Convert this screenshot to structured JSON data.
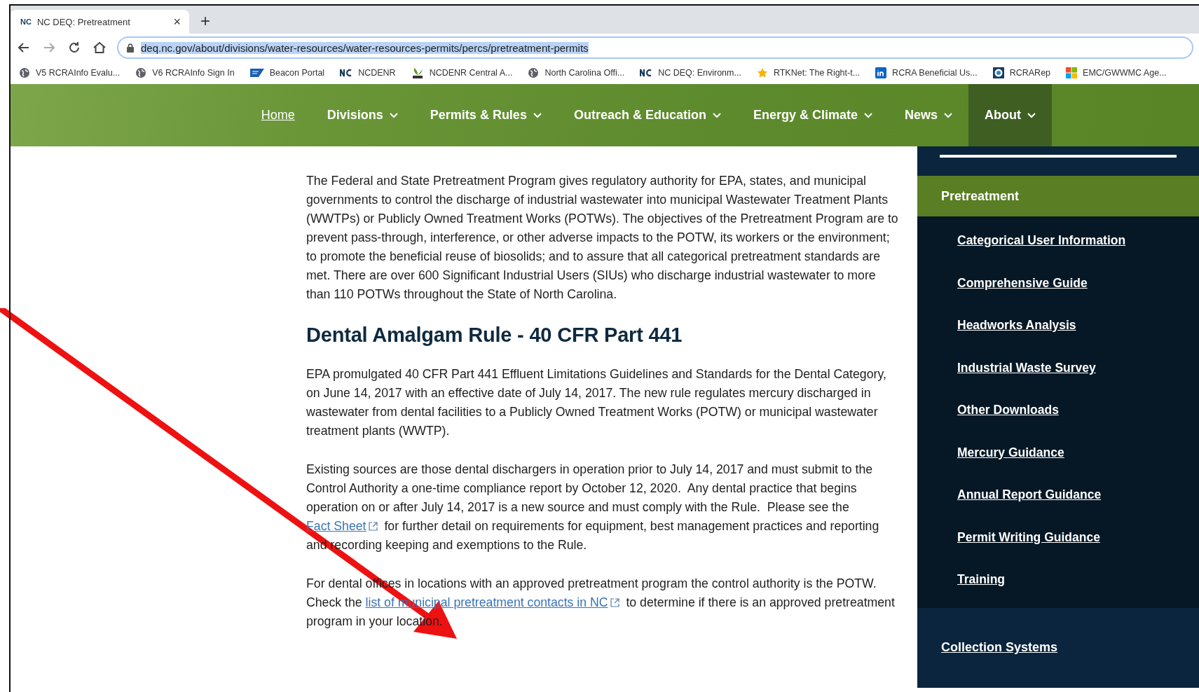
{
  "browser": {
    "tab": {
      "logo": "NC",
      "title": "NC DEQ: Pretreatment",
      "close": "×"
    },
    "new_tab": "+",
    "url": "deq.nc.gov/about/divisions/water-resources/water-resources-permits/percs/pretreatment-permits",
    "forward_disabled": true,
    "bookmarks": [
      {
        "kind": "globe",
        "label": "V5 RCRAInfo  Evalu..."
      },
      {
        "kind": "globe",
        "label": "V6 RCRAInfo Sign In"
      },
      {
        "kind": "sap",
        "label": "Beacon Portal"
      },
      {
        "kind": "nc",
        "label": "NCDENR"
      },
      {
        "kind": "denr",
        "label": "NCDENR Central A..."
      },
      {
        "kind": "globe",
        "label": "North Carolina Offi..."
      },
      {
        "kind": "nc",
        "label": "NC DEQ: Environm..."
      },
      {
        "kind": "star",
        "label": "RTKNet: The Right-t..."
      },
      {
        "kind": "linkedin",
        "label": "RCRA Beneficial Us..."
      },
      {
        "kind": "seal",
        "label": "RCRARep"
      },
      {
        "kind": "windows",
        "label": "EMC/GWWMC Age..."
      }
    ]
  },
  "nav": [
    {
      "label": "Home",
      "has_menu": false,
      "selected": false
    },
    {
      "label": "Divisions",
      "has_menu": true,
      "selected": false
    },
    {
      "label": "Permits & Rules",
      "has_menu": true,
      "selected": false
    },
    {
      "label": "Outreach & Education",
      "has_menu": true,
      "selected": false
    },
    {
      "label": "Energy & Climate",
      "has_menu": true,
      "selected": false
    },
    {
      "label": "News",
      "has_menu": true,
      "selected": false
    },
    {
      "label": "About",
      "has_menu": true,
      "selected": true
    }
  ],
  "content": [
    {
      "kind": "paragraph",
      "parts": [
        {
          "text": "The Federal and State Pretreatment Program gives regulatory authority for EPA, states, and municipal governments to control the discharge of industrial wastewater into municipal Wastewater Treatment Plants (WWTPs) or Publicly Owned Treatment Works (POTWs). The objectives of the Pretreatment Program are to prevent pass-through, interference, or other adverse impacts to the POTW, its workers or the environment; to promote the beneficial reuse of biosolids; and to assure that all categorical pretreatment standards are met. There are over 600 Significant Industrial Users (SIUs) who discharge industrial wastewater to more than 110 POTWs throughout the State of North Carolina."
        }
      ]
    },
    {
      "kind": "heading",
      "text": "Dental Amalgam Rule - 40 CFR Part 441"
    },
    {
      "kind": "paragraph",
      "parts": [
        {
          "text": "EPA promulgated 40 CFR Part 441 Effluent Limitations Guidelines and Standards for the Dental Category, on June 14, 2017 with an effective date of July 14, 2017. The new rule regulates mercury discharged in wastewater from dental facilities to a Publicly Owned Treatment Works (POTW) or municipal wastewater treatment plants (WWTP)."
        }
      ]
    },
    {
      "kind": "paragraph",
      "parts": [
        {
          "text": "Existing sources are those dental dischargers in operation prior to July 14, 2017 and must submit to the Control Authority a one-time compliance report by October 12, 2020.  Any dental practice that begins operation on or after July 14, 2017 is a new source and must comply with the Rule.  Please see the "
        },
        {
          "link": "Fact Sheet"
        },
        {
          "text": "  for further detail on requirements for equipment, best management practices and reporting and recording keeping and exemptions to the Rule."
        }
      ]
    },
    {
      "kind": "paragraph",
      "parts": [
        {
          "text": "For dental offices in locations with an approved pretreatment program the control authority is the POTW.  Check the "
        },
        {
          "link": "list of municipal pretreatment contacts in NC"
        },
        {
          "text": "  to determine if there is an approved pretreatment program in your location."
        }
      ]
    }
  ],
  "sidebar": [
    {
      "label": "Pretreatment",
      "expanded": true,
      "children": [
        {
          "label": "Categorical User Information"
        },
        {
          "label": "Comprehensive Guide"
        },
        {
          "label": "Headworks Analysis"
        },
        {
          "label": "Industrial Waste Survey"
        },
        {
          "label": "Other Downloads"
        },
        {
          "label": "Mercury Guidance"
        },
        {
          "label": "Annual Report Guidance"
        },
        {
          "label": "Permit Writing Guidance"
        },
        {
          "label": "Training"
        }
      ]
    },
    {
      "label": "Collection Systems",
      "expanded": false
    }
  ]
}
